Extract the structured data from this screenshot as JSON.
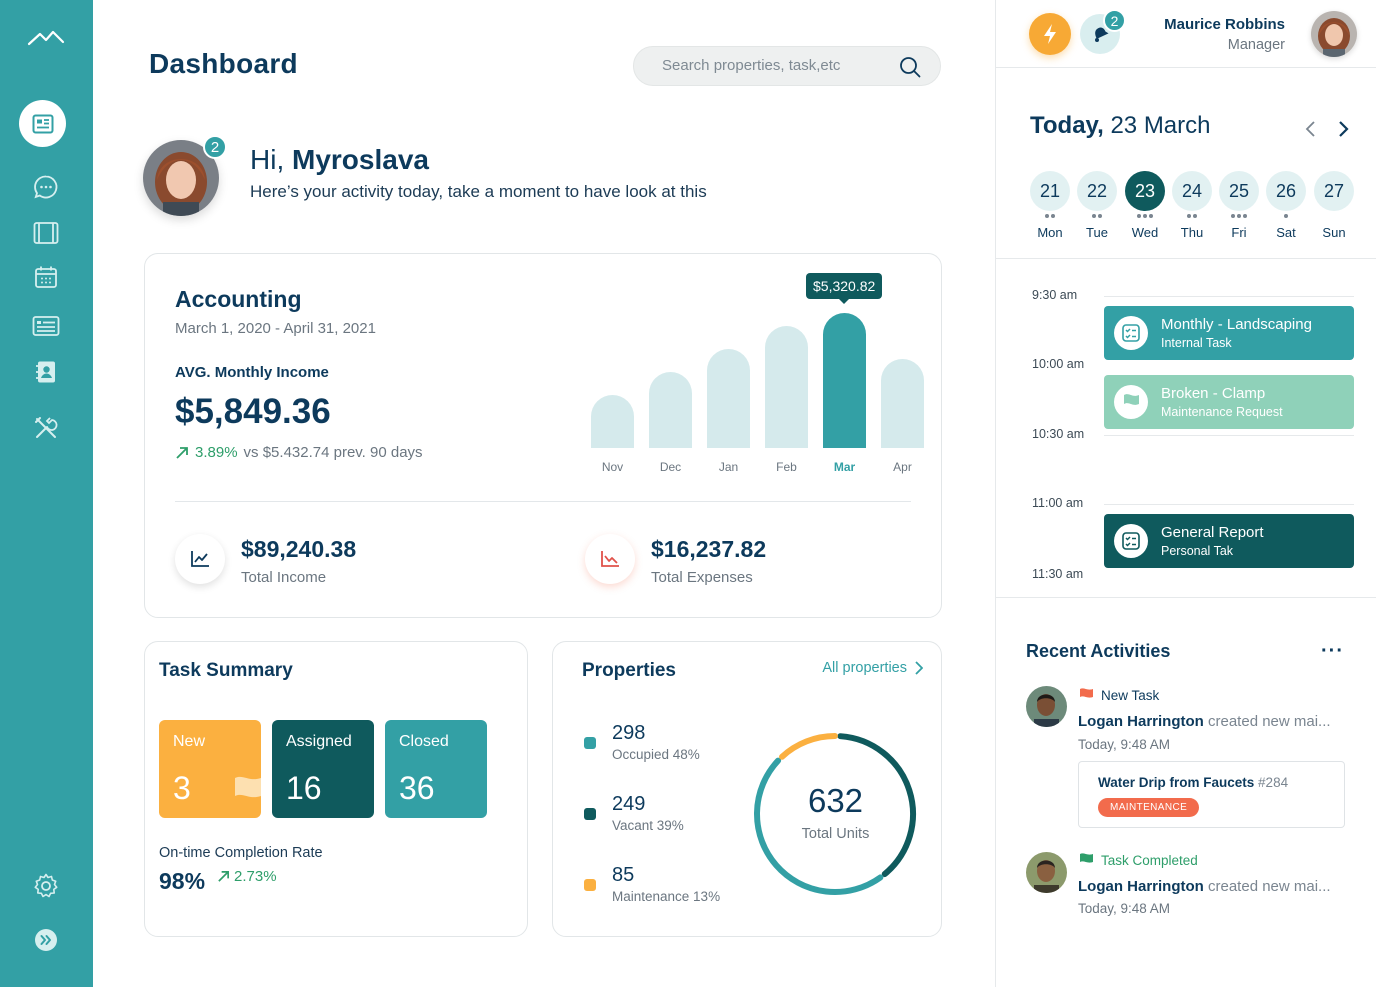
{
  "sidebar": {
    "logo_icon": "mountain-logo-icon",
    "items": [
      {
        "icon": "dashboard-icon",
        "active": true
      },
      {
        "icon": "chat-icon",
        "active": false
      },
      {
        "icon": "film-frame-icon",
        "active": false
      },
      {
        "icon": "calendar-icon",
        "active": false
      },
      {
        "icon": "list-card-icon",
        "active": false
      },
      {
        "icon": "contacts-icon",
        "active": false
      },
      {
        "icon": "tools-icon",
        "active": false
      }
    ],
    "settings_icon": "gear-icon",
    "expand_icon": "expand-arrows-icon"
  },
  "header": {
    "title": "Dashboard",
    "search_placeholder": "Search properties, task,etc"
  },
  "greeting": {
    "hi": "Hi,",
    "name": "Myroslava",
    "subtitle": "Here’s your activity today, take a moment to have look at this",
    "badge": "2"
  },
  "accounting": {
    "title": "Accounting",
    "range": "March 1, 2020 - April 31, 2021",
    "avg_label": "AVG. Monthly Income",
    "avg_value": "$5,849.36",
    "trend_pct": "3.89%",
    "trend_text": "vs $5.432.74 prev. 90 days",
    "tooltip": "$5,320.82",
    "income_value": "$89,240.38",
    "income_label": "Total Income",
    "expense_value": "$16,237.82",
    "expense_label": "Total Expenses"
  },
  "chart_data": {
    "type": "bar",
    "categories": [
      "Nov",
      "Dec",
      "Jan",
      "Feb",
      "Mar",
      "Apr"
    ],
    "values": [
      2100,
      3000,
      3900,
      4800,
      5320.82,
      3500
    ],
    "highlight": "Mar",
    "ylim": [
      0,
      6000
    ],
    "title": "",
    "xlabel": "",
    "ylabel": ""
  },
  "tasks": {
    "title": "Task Summary",
    "tiles": [
      {
        "label": "New",
        "value": "3",
        "color": "#fbb040"
      },
      {
        "label": "Assigned",
        "value": "16",
        "color": "#0f5a5d"
      },
      {
        "label": "Closed",
        "value": "36",
        "color": "#33a0a5"
      }
    ],
    "completion_label": "On-time Completion Rate",
    "completion_value": "98%",
    "completion_trend": "2.73%"
  },
  "properties": {
    "title": "Properties",
    "link": "All properties",
    "legend": [
      {
        "num": "298",
        "label": "Occupied 48%",
        "color": "#33a0a5",
        "fraction": 0.48
      },
      {
        "num": "249",
        "label": "Vacant 39%",
        "color": "#0f5a5d",
        "fraction": 0.39
      },
      {
        "num": "85",
        "label": "Maintenance 13%",
        "color": "#fbb040",
        "fraction": 0.13
      }
    ],
    "total": "632",
    "total_label": "Total Units"
  },
  "user": {
    "name": "Maurice Robbins",
    "role": "Manager",
    "notifications": "2"
  },
  "calendar": {
    "today_label": "Today,",
    "today_date": "23 March",
    "days": [
      {
        "num": "21",
        "name": "Mon",
        "dots": 2,
        "selected": false
      },
      {
        "num": "22",
        "name": "Tue",
        "dots": 2,
        "selected": false
      },
      {
        "num": "23",
        "name": "Wed",
        "dots": 3,
        "selected": true
      },
      {
        "num": "24",
        "name": "Thu",
        "dots": 2,
        "selected": false
      },
      {
        "num": "25",
        "name": "Fri",
        "dots": 3,
        "selected": false
      },
      {
        "num": "26",
        "name": "Sat",
        "dots": 1,
        "selected": false
      },
      {
        "num": "27",
        "name": "Sun",
        "dots": 0,
        "selected": false
      }
    ]
  },
  "schedule": {
    "times": [
      "9:30 am",
      "10:00 am",
      "10:30 am",
      "11:00 am",
      "11:30 am"
    ],
    "events": [
      {
        "title": "Monthly - Landscaping",
        "sub": "Internal Task",
        "color": "#33a0a5",
        "icon": "checklist-icon"
      },
      {
        "title": "Broken - Clamp",
        "sub": "Maintenance Request",
        "color": "#8fd1b9",
        "icon": "flag-icon"
      },
      {
        "title": "General Report",
        "sub": "Personal Tak",
        "color": "#0f5a5d",
        "icon": "checklist-icon"
      }
    ]
  },
  "activities": {
    "title": "Recent Activities",
    "items": [
      {
        "kind": "New Task",
        "flag_color": "#f26b4c",
        "user": "Logan Harrington",
        "text": "created new mai...",
        "time": "Today, 9:48 AM"
      },
      {
        "kind": "Task Completed",
        "flag_color": "#2e9e6a",
        "user": "Logan Harrington",
        "text": "created new mai...",
        "time": "Today, 9:48 AM"
      }
    ],
    "work_order": {
      "title": "Water Drip from Faucets",
      "id": "#284",
      "badge": "MAINTENANCE"
    }
  }
}
